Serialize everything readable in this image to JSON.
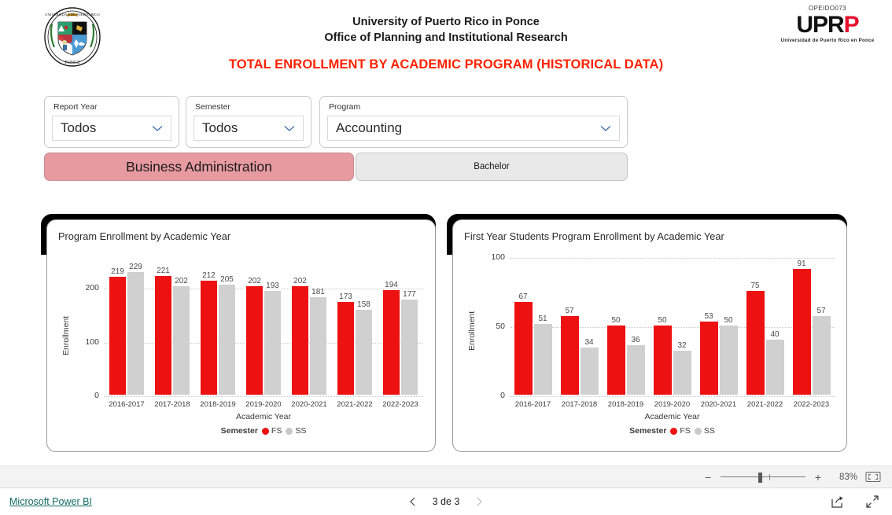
{
  "header": {
    "seal_icon": "uprp-seal-icon",
    "org_line1": "University of Puerto Rico in Ponce",
    "org_line2": "Office of Planning and Institutional Research",
    "report_title": "TOTAL ENROLLMENT BY ACADEMIC PROGRAM (HISTORICAL DATA)",
    "logo": {
      "code": "OPEIDO073",
      "word_black": "UPR",
      "word_red": "P",
      "subtitle": "Universidad de Puerto Rico en Ponce"
    }
  },
  "slicers": [
    {
      "label": "Report Year",
      "value": "Todos",
      "icon": "chevron-down-icon"
    },
    {
      "label": "Semester",
      "value": "Todos",
      "icon": "chevron-down-icon"
    },
    {
      "label": "Program",
      "value": "Accounting",
      "icon": "chevron-down-icon"
    }
  ],
  "tabs": [
    {
      "label": "Business Administration",
      "selected": true,
      "color": "#e79aa0"
    },
    {
      "label": "Bachelor",
      "selected": false,
      "color": "#e9e9e9"
    }
  ],
  "colors": {
    "series_fs": "#ee1111",
    "series_ss": "#d0d0d0",
    "title_red": "#ff2200",
    "link_teal": "#116b62",
    "selected_tab": "#e79aa0"
  },
  "chart_data": [
    {
      "type": "bar",
      "title": "Program Enrollment by Academic Year",
      "xlabel": "Academic Year",
      "ylabel": "Enrollment",
      "legend_title": "Semester",
      "legend_position": "bottom",
      "grid": true,
      "ylim": [
        0,
        240
      ],
      "yticks": [
        0,
        100,
        200
      ],
      "categories": [
        "2016-2017",
        "2017-2018",
        "2018-2019",
        "2019-2020",
        "2020-2021",
        "2021-2022",
        "2022-2023"
      ],
      "series": [
        {
          "name": "FS",
          "color": "#ee1111",
          "values": [
            219,
            221,
            212,
            202,
            202,
            173,
            194
          ]
        },
        {
          "name": "SS",
          "color": "#d0d0d0",
          "values": [
            229,
            202,
            205,
            193,
            181,
            158,
            177
          ]
        }
      ]
    },
    {
      "type": "bar",
      "title": "First Year Students Program Enrollment by Academic Year",
      "xlabel": "Academic Year",
      "ylabel": "Enrollment",
      "legend_title": "Semester",
      "legend_position": "bottom",
      "grid": true,
      "ylim": [
        0,
        100
      ],
      "yticks": [
        0,
        50,
        100
      ],
      "categories": [
        "2016-2017",
        "2017-2018",
        "2018-2019",
        "2019-2020",
        "2020-2021",
        "2021-2022",
        "2022-2023"
      ],
      "series": [
        {
          "name": "FS",
          "color": "#ee1111",
          "values": [
            67,
            57,
            50,
            50,
            53,
            75,
            91
          ]
        },
        {
          "name": "SS",
          "color": "#d0d0d0",
          "values": [
            51,
            34,
            36,
            32,
            50,
            40,
            57
          ]
        }
      ]
    }
  ],
  "zoombar": {
    "minus": "−",
    "plus": "+",
    "percent": "83%",
    "fit_icon": "fit-to-page-icon"
  },
  "statusbar": {
    "brand_link": "Microsoft Power BI",
    "page_text": "3 de 3",
    "prev_icon": "chevron-left-icon",
    "next_icon": "chevron-right-icon",
    "share_icon": "share-icon",
    "fullscreen_icon": "fullscreen-icon"
  }
}
